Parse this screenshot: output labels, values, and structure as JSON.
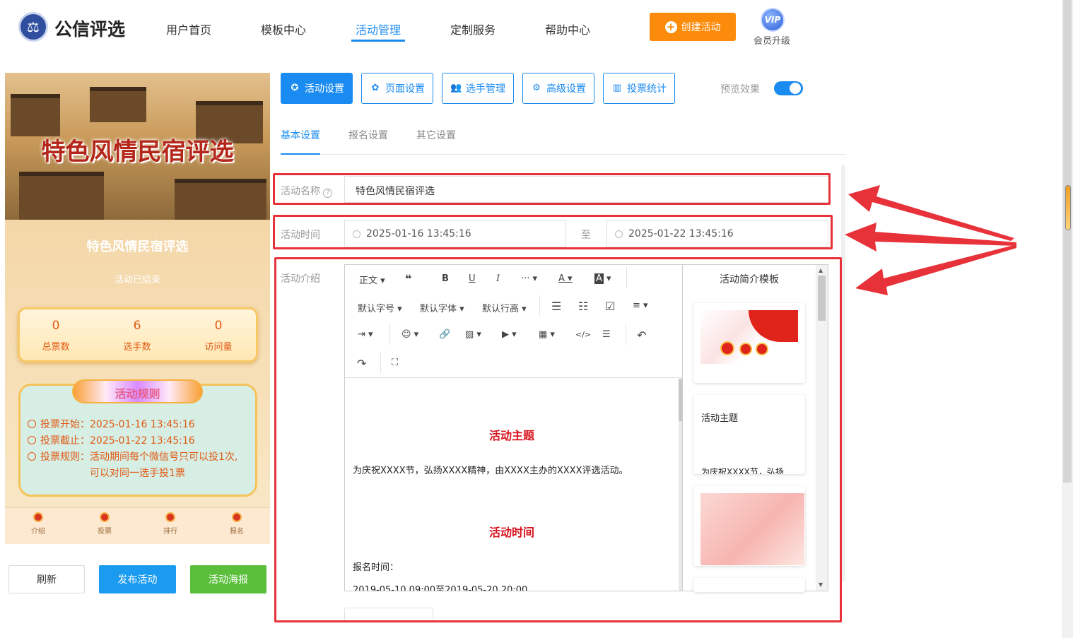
{
  "header": {
    "brand": "公信评选",
    "nav": [
      "用户首页",
      "模板中心",
      "活动管理",
      "定制服务",
      "帮助中心"
    ],
    "active_nav": "活动管理",
    "create_button": "创建活动",
    "vip_badge": "VIP",
    "vip_label": "会员升级"
  },
  "preview": {
    "banner_title": "特色风情民宿评选",
    "title": "特色风情民宿评选",
    "status": "活动已结束",
    "stats": [
      {
        "value": "0",
        "label": "总票数"
      },
      {
        "value": "6",
        "label": "选手数"
      },
      {
        "value": "0",
        "label": "访问量"
      }
    ],
    "rules_title": "活动规则",
    "rules": [
      "投票开始：2025-01-16 13:45:16",
      "投票截止：2025-01-22 13:45:16",
      "投票规则：活动期间每个微信号只可以投1次,",
      "可以对同一选手投1票"
    ],
    "bottom_tabs": [
      "介绍",
      "投票",
      "排行",
      "报名"
    ]
  },
  "actions": {
    "refresh": "刷新",
    "publish": "发布活动",
    "poster": "活动海报"
  },
  "tool_tabs": [
    {
      "label": "活动设置",
      "icon": "star-icon"
    },
    {
      "label": "页面设置",
      "icon": "gear-icon"
    },
    {
      "label": "选手管理",
      "icon": "users-icon"
    },
    {
      "label": "高级设置",
      "icon": "settings-icon"
    },
    {
      "label": "投票统计",
      "icon": "bar-chart-icon"
    }
  ],
  "preview_toggle": {
    "label": "预览效果",
    "on": true
  },
  "sub_tabs": [
    "基本设置",
    "报名设置",
    "其它设置"
  ],
  "form": {
    "name_label": "活动名称",
    "name_value": "特色风情民宿评选",
    "time_label": "活动时间",
    "start_time": "2025-01-16 13:45:16",
    "separator": "至",
    "end_time": "2025-01-22 13:45:16",
    "intro_label": "活动介绍"
  },
  "editor": {
    "toolbar_row1": [
      "正文",
      "❝",
      "B",
      "U",
      "I",
      "···",
      "A",
      "A"
    ],
    "toolbar_row2": [
      "默认字号",
      "默认字体",
      "默认行高"
    ],
    "heading1": "活动主题",
    "para1": "为庆祝XXXX节，弘扬XXXX精神，由XXXX主办的XXXX评选活动。",
    "heading2": "活动时间",
    "para2": "报名时间：",
    "para3": "2019-05-10 09:00至2019-05-20 20:00"
  },
  "templates": {
    "title": "活动简介模板",
    "card2_title": "活动主题",
    "card2_text": "为庆祝XXXX节，弘扬"
  },
  "colors": {
    "accent": "#1a8bf0",
    "orange": "#fc8b0b",
    "highlight": "#e8323a",
    "green": "#5bbf3c"
  }
}
